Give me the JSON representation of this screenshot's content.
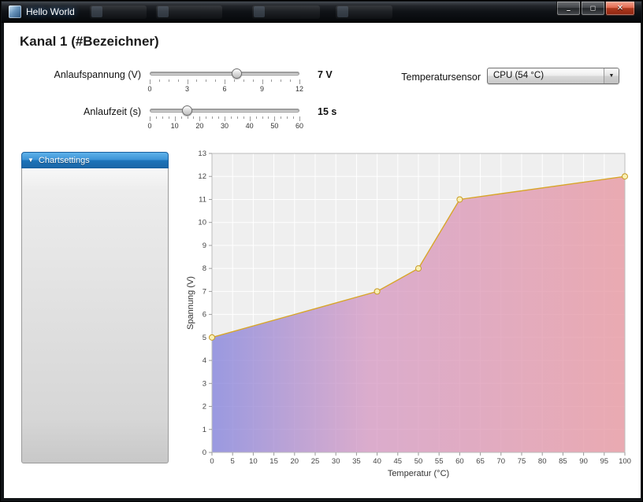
{
  "window": {
    "title": "Hello World",
    "controls": {
      "minimize": "–",
      "maximize": "◻",
      "close": "✕"
    }
  },
  "page": {
    "title": "Kanal 1 (#Bezeichner)"
  },
  "sliders": [
    {
      "label": "Anlaufspannung (V)",
      "value": 7,
      "min": 0,
      "max": 12,
      "value_label": "7 V",
      "major_ticks": [
        0,
        3,
        6,
        9,
        12
      ],
      "minor_per_major": 4
    },
    {
      "label": "Anlaufzeit (s)",
      "value": 15,
      "min": 0,
      "max": 60,
      "value_label": "15 s",
      "major_ticks": [
        0,
        10,
        20,
        30,
        40,
        50,
        60
      ],
      "minor_per_major": 4
    }
  ],
  "sensor": {
    "label": "Temperatursensor",
    "selected": "CPU (54 °C)",
    "arrow_icon": "▼"
  },
  "chartsettings": {
    "title": "Chartsettings",
    "collapse_icon": "▼"
  },
  "chart_data": {
    "type": "area",
    "points": [
      [
        0,
        5
      ],
      [
        40,
        7
      ],
      [
        50,
        8
      ],
      [
        60,
        11
      ],
      [
        100,
        12
      ]
    ],
    "xlabel": "Temperatur (°C)",
    "ylabel": "Spannung (V)",
    "xlim": [
      0,
      100
    ],
    "ylim": [
      0,
      13
    ],
    "x_tick_step": 5,
    "y_tick_step": 1,
    "grid": true,
    "legend": false,
    "plot_bg": "#efefef",
    "grid_color": "#ffffff",
    "border_color": "#bdbdbd",
    "tick_color": "#9a9a9a",
    "line_color": "#d8a62a",
    "marker_fill": "#f9f0b4",
    "marker_stroke": "#c79b25",
    "area_gradient": [
      {
        "offset": 0,
        "color": "#8181dc",
        "opacity": 0.78
      },
      {
        "offset": 0.38,
        "color": "#d392bf",
        "opacity": 0.72
      },
      {
        "offset": 1,
        "color": "#e899a2",
        "opacity": 0.8
      }
    ]
  }
}
